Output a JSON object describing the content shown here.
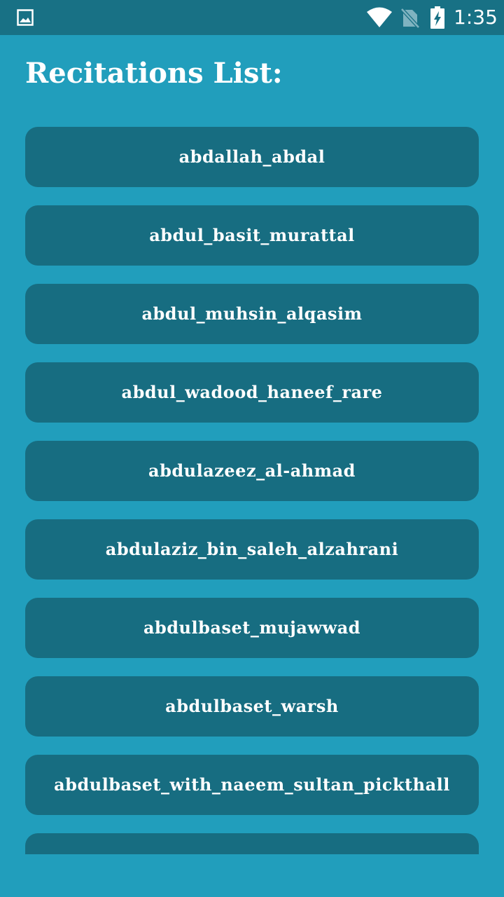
{
  "status_bar": {
    "time": "1:35",
    "icons": [
      "image-icon",
      "wifi-icon",
      "no-sim-icon",
      "battery-charging-icon"
    ]
  },
  "page": {
    "title": "Recitations List:"
  },
  "recitations": [
    "abdallah_abdal",
    "abdul_basit_murattal",
    "abdul_muhsin_alqasim",
    "abdul_wadood_haneef_rare",
    "abdulazeez_al-ahmad",
    "abdulaziz_bin_saleh_alzahrani",
    "abdulbaset_mujawwad",
    "abdulbaset_warsh",
    "abdulbaset_with_naeem_sultan_pickthall",
    ""
  ],
  "colors": {
    "background": "#219ebc",
    "status_bar": "#187185",
    "button": "#176d81",
    "text": "#ffffff"
  }
}
